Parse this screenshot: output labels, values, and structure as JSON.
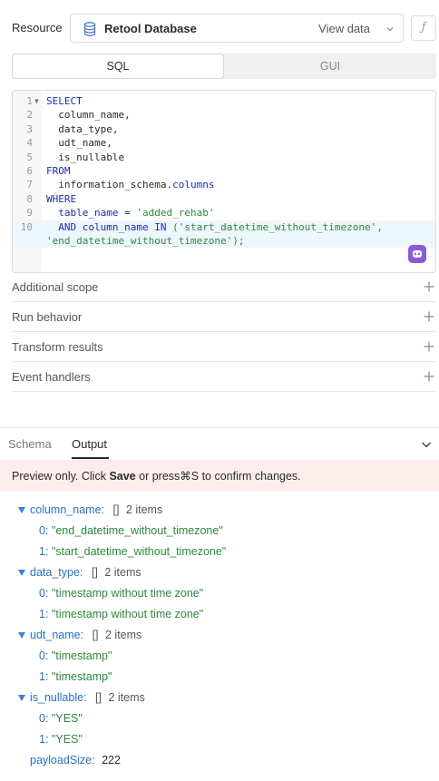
{
  "resource": {
    "label": "Resource",
    "selected": "Retool Database",
    "view_data": "View data",
    "fx_icon": "ƒ"
  },
  "mode_tabs": {
    "sql": "SQL",
    "gui": "GUI"
  },
  "editor": {
    "line_numbers": [
      "1",
      "2",
      "3",
      "4",
      "5",
      "6",
      "7",
      "8",
      "9",
      "10"
    ],
    "lines": [
      "SELECT",
      "column_name,",
      "data_type,",
      "udt_name,",
      "is_nullable",
      "FROM",
      "information_schema.",
      "columns",
      "WHERE",
      "table_name",
      "=",
      "'added_rehab'",
      "AND",
      "column_name",
      "IN",
      "('start_datetime_without_timezone',",
      "'end_datetime_without_timezone');"
    ]
  },
  "sections": [
    "Additional scope",
    "Run behavior",
    "Transform results",
    "Event handlers"
  ],
  "bottom_tabs": {
    "schema": "Schema",
    "output": "Output"
  },
  "preview": {
    "prefix": "Preview only.  Click ",
    "bold": "Save",
    "suffix": " or press⌘S to confirm changes."
  },
  "output": {
    "brackets": "[]",
    "groups": [
      {
        "key": "column_name:",
        "count": "2 items",
        "items": [
          {
            "idx": "0:",
            "val": "\"end_datetime_without_timezone\""
          },
          {
            "idx": "1:",
            "val": "\"start_datetime_without_timezone\""
          }
        ]
      },
      {
        "key": "data_type:",
        "count": "2 items",
        "items": [
          {
            "idx": "0:",
            "val": "\"timestamp without time zone\""
          },
          {
            "idx": "1:",
            "val": "\"timestamp without time zone\""
          }
        ]
      },
      {
        "key": "udt_name:",
        "count": "2 items",
        "items": [
          {
            "idx": "0:",
            "val": "\"timestamp\""
          },
          {
            "idx": "1:",
            "val": "\"timestamp\""
          }
        ]
      },
      {
        "key": "is_nullable:",
        "count": "2 items",
        "items": [
          {
            "idx": "0:",
            "val": "\"YES\""
          },
          {
            "idx": "1:",
            "val": "\"YES\""
          }
        ]
      }
    ],
    "payload_key": "payloadSize:",
    "payload_value": "222"
  },
  "colors": {
    "keyword": "#1d2bb3",
    "string": "#2c8a3b",
    "tree_key": "#2a6fc9",
    "banner": "#fceded",
    "ai_button": "#8b5bd6"
  },
  "icons": [
    "database-icon",
    "chevron-down-icon",
    "fx-icon",
    "ai-assist-icon",
    "plus-icon",
    "collapse-chevron-icon",
    "expand-triangle-icon"
  ]
}
